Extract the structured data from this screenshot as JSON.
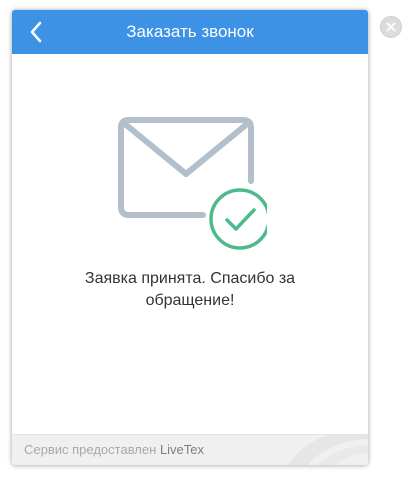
{
  "header": {
    "title": "Заказать звонок",
    "back_icon": "chevron-left-icon",
    "background_color": "#3d92e6"
  },
  "confirmation": {
    "icon": "envelope-check-icon",
    "message": "Заявка принята. Спасибо за обращение!",
    "envelope_color": "#b3bfca",
    "check_color": "#4dba8b"
  },
  "footer": {
    "prefix": "Сервис предоставлен",
    "brand": "LiveTex"
  },
  "close": {
    "icon": "close-icon"
  }
}
